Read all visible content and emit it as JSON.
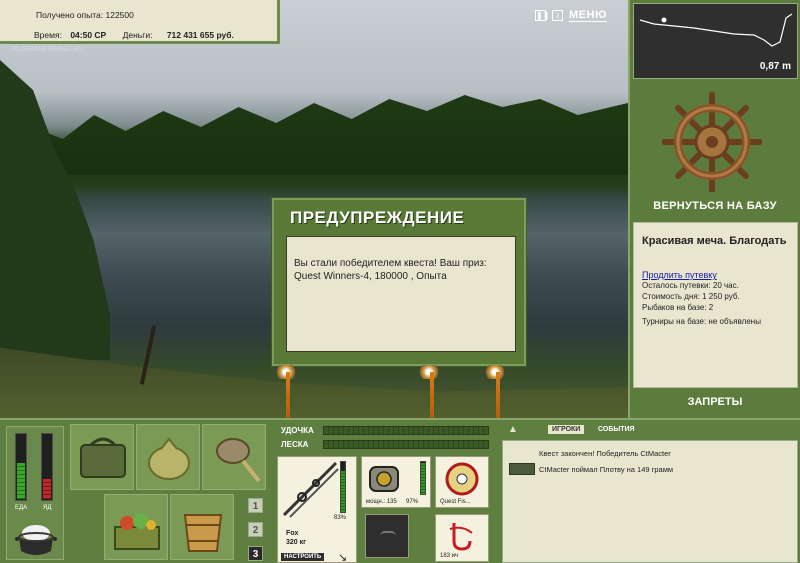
{
  "hud": {
    "exp_label": "Получено опыта:",
    "exp_value": "122500",
    "time_label": "Время:",
    "time_value": "04:50 СР",
    "money_label": "Деньги:",
    "money_value": "712 431 655 руб.",
    "watermark": "RUSSIANFISHING.RU"
  },
  "top_controls": {
    "pause_icon": "pause-icon",
    "sound_icon": "sound-icon",
    "menu_label": "МЕНЮ"
  },
  "depth": {
    "value": "0,87 m"
  },
  "right_panel": {
    "return_label": "ВЕРНУТЬСЯ НА БАЗУ",
    "base_title": "Красивая меча. Благодать",
    "extend_link": "Продлить путевку",
    "lines": [
      "Осталось путевки: 20 час.",
      "Стоимость дня: 1 250 руб.",
      "Рыбаков на базе: 2",
      "Турниры на базе: не объявлены"
    ],
    "bans_label": "ЗАПРЕТЫ"
  },
  "dialog": {
    "title": "ПРЕДУПРЕЖДЕНИЕ",
    "message": "Вы стали победителем квеста! Ваш приз: Quest Winners-4, 180000 , Опыта"
  },
  "gauges": {
    "food_label": "ЕДА",
    "poison_label": "ЯД",
    "food_level": 0.55,
    "poison_level": 0.3
  },
  "inventory": {
    "pages": [
      "1",
      "2",
      "3"
    ],
    "active_page": "3"
  },
  "tackle": {
    "rod_label": "УДОЧКА",
    "line_label": "ЛЕСКА",
    "rod_name": "Fox",
    "rod_weight": "320 кг",
    "rod_pct": "83%",
    "rod_level": 0.83,
    "setup_label": "НАСТРОИТЬ",
    "reel_power": "мощн.: 135",
    "reel_pct": "97%",
    "reel_level": 0.97,
    "line_name": "Quest Fis...",
    "hook_text": "183 ич"
  },
  "events": {
    "tab_players": "ИГРОКИ",
    "tab_events": "СОБЫТИЯ",
    "items": [
      "Квест закончен! Победитель CtMacter",
      "CtMacter поймал Плотву на 149 грамм"
    ]
  },
  "colors": {
    "panel_green": "#5f7f41",
    "paper": "#e9e6cf",
    "rod_orange": "#d77c18"
  }
}
